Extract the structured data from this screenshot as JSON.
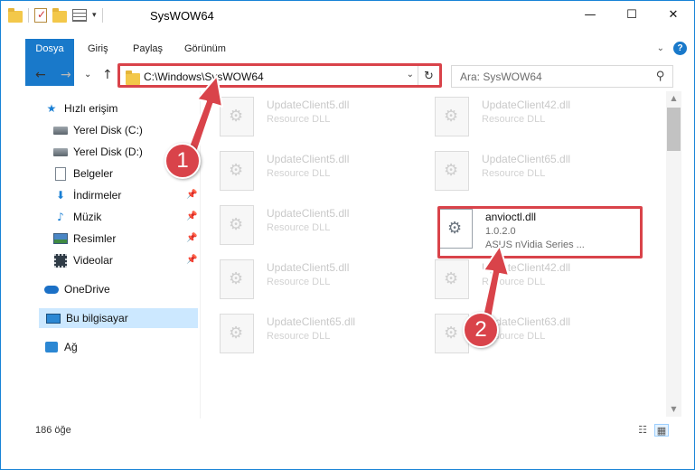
{
  "window": {
    "title": "SysWOW64",
    "controls": {
      "minimize": "—",
      "maximize": "☐",
      "close": "✕"
    }
  },
  "ribbon": {
    "tabs": [
      "Dosya",
      "Giriş",
      "Paylaş",
      "Görünüm"
    ],
    "help": "?"
  },
  "navigation": {
    "back": "←",
    "forward": "→",
    "recent": "⌄",
    "up": "↑",
    "address": "C:\\Windows\\SysWOW64",
    "refresh": "↻",
    "search_placeholder": "Ara: SysWOW64"
  },
  "sidebar": {
    "items": [
      {
        "label": "Hızlı erişim",
        "icon": "star-icon"
      },
      {
        "label": "Yerel Disk (C:)",
        "icon": "drive-icon"
      },
      {
        "label": "Yerel Disk (D:)",
        "icon": "drive-icon"
      },
      {
        "label": "Belgeler",
        "icon": "documents-icon"
      },
      {
        "label": "İndirmeler",
        "icon": "downloads-icon",
        "pinned": true
      },
      {
        "label": "Müzik",
        "icon": "music-icon",
        "pinned": true
      },
      {
        "label": "Resimler",
        "icon": "pictures-icon",
        "pinned": true
      },
      {
        "label": "Videolar",
        "icon": "videos-icon",
        "pinned": true
      },
      {
        "label": "OneDrive",
        "icon": "onedrive-icon"
      },
      {
        "label": "Bu bilgisayar",
        "icon": "computer-icon",
        "selected": true
      },
      {
        "label": "Ağ",
        "icon": "network-icon"
      }
    ]
  },
  "files": [
    {
      "name": "UpdateClient5.dll",
      "desc": "Resource DLL"
    },
    {
      "name": "UpdateClient42.dll",
      "desc": "Resource DLL"
    },
    {
      "name": "UpdateClient5.dll",
      "desc": "Resource DLL"
    },
    {
      "name": "UpdateClient65.dll",
      "desc": "Resource DLL"
    },
    {
      "name": "UpdateClient5.dll",
      "desc": "Resource DLL"
    },
    {
      "name": "anvioctl.dll",
      "version": "1.0.2.0",
      "desc": "ASUS nVidia Series ...",
      "highlighted": true
    },
    {
      "name": "UpdateClient5.dll",
      "desc": "Resource DLL"
    },
    {
      "name": "UpdateClient42.dll",
      "desc": "Resource DLL"
    },
    {
      "name": "UpdateClient65.dll",
      "desc": "Resource DLL"
    },
    {
      "name": "UpdateClient63.dll",
      "desc": "Resource DLL"
    }
  ],
  "status": {
    "item_count": "186 öğe"
  },
  "callouts": {
    "step1": "1",
    "step2": "2",
    "color": "#d9434a"
  },
  "colors": {
    "accent": "#1979ca",
    "selection": "#cce8ff"
  }
}
